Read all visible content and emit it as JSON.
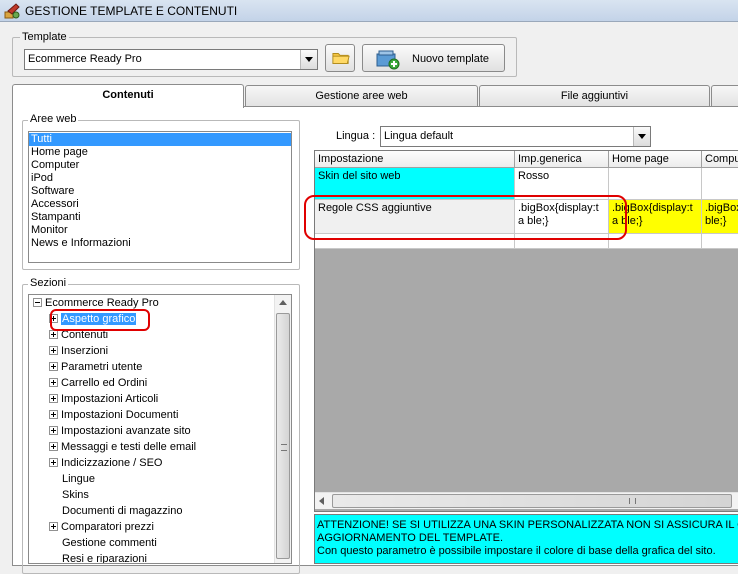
{
  "window": {
    "title": "GESTIONE TEMPLATE E CONTENUTI",
    "icon": "app-tools-icon"
  },
  "template_group": {
    "legend": "Template",
    "selected": "Ecommerce Ready Pro",
    "folder_icon": "folder-icon",
    "new_button_label": "Nuovo template",
    "new_button_icon": "new-template-icon"
  },
  "tabs": [
    {
      "label": "Contenuti",
      "active": true
    },
    {
      "label": "Gestione aree web",
      "active": false
    },
    {
      "label": "File aggiuntivi",
      "active": false
    }
  ],
  "aree_web": {
    "legend": "Aree web",
    "items": [
      "Tutti",
      "Home page",
      "Computer",
      "iPod",
      "Software",
      "Accessori",
      "Stampanti",
      "Monitor",
      "News e Informazioni"
    ],
    "selected_index": 0
  },
  "sezioni": {
    "legend": "Sezioni",
    "root": "Ecommerce Ready Pro",
    "items": [
      {
        "label": "Aspetto grafico",
        "expandable": true,
        "selected": true
      },
      {
        "label": "Contenuti",
        "expandable": true
      },
      {
        "label": "Inserzioni",
        "expandable": true
      },
      {
        "label": "Parametri utente",
        "expandable": true
      },
      {
        "label": "Carrello ed Ordini",
        "expandable": true
      },
      {
        "label": "Impostazioni Articoli",
        "expandable": true
      },
      {
        "label": "Impostazioni Documenti",
        "expandable": true
      },
      {
        "label": "Impostazioni avanzate sito",
        "expandable": true
      },
      {
        "label": "Messaggi e testi delle email",
        "expandable": true
      },
      {
        "label": "Indicizzazione / SEO",
        "expandable": true
      },
      {
        "label": "Lingue",
        "expandable": false
      },
      {
        "label": "Skins",
        "expandable": false
      },
      {
        "label": "Documenti di magazzino",
        "expandable": false
      },
      {
        "label": "Comparatori prezzi",
        "expandable": true
      },
      {
        "label": "Gestione commenti",
        "expandable": false
      },
      {
        "label": "Resi e riparazioni",
        "expandable": false
      }
    ]
  },
  "lingua": {
    "label": "Lingua :",
    "selected": "Lingua default"
  },
  "grid": {
    "headers": [
      "Impostazione",
      "Imp.generica",
      "Home page",
      "Compu"
    ],
    "rows": [
      {
        "name": "Skin del sito web",
        "generic": "Rosso",
        "home": "",
        "computer": ""
      },
      {
        "name": "Regole CSS aggiuntive",
        "generic": ".bigBox{display:ta ble;}",
        "home": ".bigBox{display:ta ble;}",
        "computer": ".bigBox ble;}"
      }
    ]
  },
  "info": {
    "line1": "ATTENZIONE! SE SI UTILIZZA UNA SKIN PERSONALIZZATA NON SI ASSICURA IL CORR",
    "line2": "AGGIORNAMENTO DEL TEMPLATE.",
    "line3": "Con questo parametro è possibile impostare il colore di base della grafica del sito."
  },
  "colors": {
    "highlight": "#3399ff",
    "cyan": "#00ffff",
    "yellow": "#ffff00",
    "annotation": "#e00000"
  }
}
